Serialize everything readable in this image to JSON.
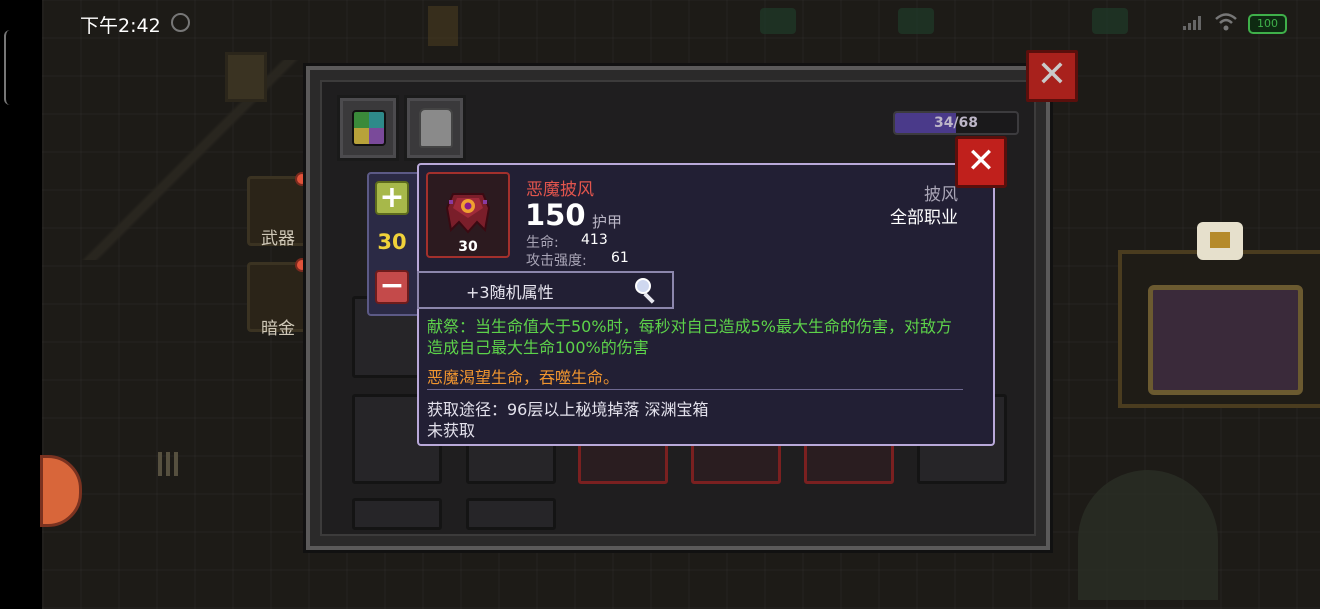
{
  "status_bar": {
    "time": "下午2:42",
    "battery": "100"
  },
  "side_menu": {
    "weapons_label": "武器",
    "dark_gold_label": "暗金"
  },
  "inventory": {
    "progress_text": "34/68",
    "progress_fraction": 0.5
  },
  "stepper": {
    "value": "30"
  },
  "item": {
    "name": "恶魔披风",
    "level": "30",
    "armor_value": "150",
    "armor_label": "护甲",
    "stats": [
      {
        "label": "生命:",
        "value": "413"
      },
      {
        "label": "攻击强度:",
        "value": "61"
      }
    ],
    "slot_type": "披风",
    "class_requirement": "全部职业",
    "random_attributes": "+3随机属性",
    "effect_text": "献祭：当生命值大于50%时，每秒对自己造成5%最大生命的伤害，对敌方造成自己最大生命100%的伤害",
    "flavor_text": "恶魔渴望生命，吞噬生命。",
    "source_text": "获取途径：96层以上秘境掉落 深渊宝箱",
    "status_text": "未获取"
  },
  "colors": {
    "item_name": "#e2554d",
    "effect": "#5dd24a",
    "flavor": "#f0952f",
    "stepper_value": "#f0d23a"
  },
  "icons": [
    "alarm-icon",
    "signal-icon",
    "wifi-icon",
    "battery-icon",
    "close-icon",
    "plus-icon",
    "minus-icon",
    "cloak-icon",
    "magnifier-icon"
  ]
}
